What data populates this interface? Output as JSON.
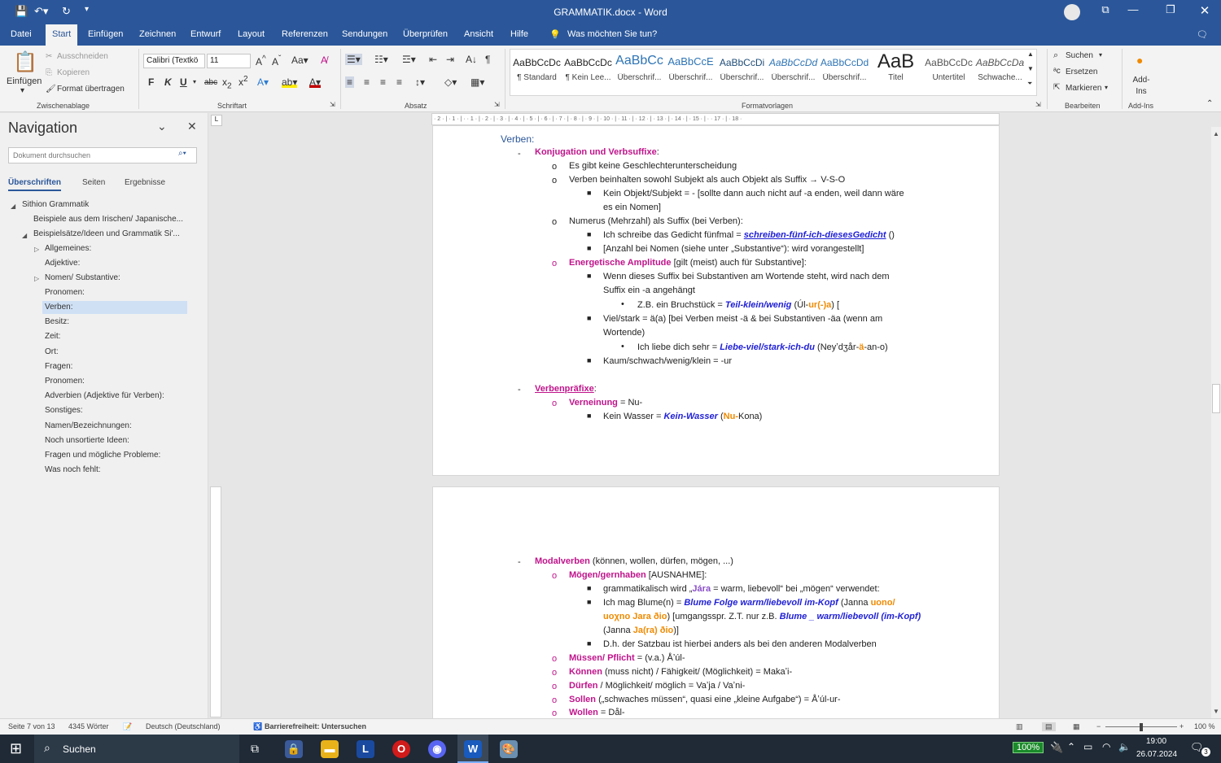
{
  "window": {
    "title": "GRAMMATIK.docx  -  Word"
  },
  "tabs": [
    "Datei",
    "Start",
    "Einfügen",
    "Zeichnen",
    "Entwurf",
    "Layout",
    "Referenzen",
    "Sendungen",
    "Überprüfen",
    "Ansicht",
    "Hilfe"
  ],
  "tell_me": "Was möchten Sie tun?",
  "ribbon": {
    "clipboard": {
      "paste": "Einfügen",
      "cut": "Ausschneiden",
      "copy": "Kopieren",
      "format_painter": "Format übertragen",
      "label": "Zwischenablage"
    },
    "font": {
      "name": "Calibri (Textkö",
      "size": "11",
      "label": "Schriftart"
    },
    "paragraph": {
      "label": "Absatz"
    },
    "styles": {
      "label": "Formatvorlagen",
      "items": [
        {
          "preview": "AaBbCcDc",
          "name": "¶ Standard"
        },
        {
          "preview": "AaBbCcDc",
          "name": "¶ Kein Lee..."
        },
        {
          "preview": "AaBbCc",
          "name": "Überschrif..."
        },
        {
          "preview": "AaBbCcE",
          "name": "Überschrif..."
        },
        {
          "preview": "AaBbCcDi",
          "name": "Überschrif..."
        },
        {
          "preview": "AaBbCcDd",
          "name": "Überschrif..."
        },
        {
          "preview": "AaBbCcDd",
          "name": "Überschrif..."
        },
        {
          "preview": "AaB",
          "name": "Titel"
        },
        {
          "preview": "AaBbCcDc",
          "name": "Untertitel"
        },
        {
          "preview": "AaBbCcDa",
          "name": "Schwache..."
        }
      ]
    },
    "editing": {
      "search": "Suchen",
      "replace": "Ersetzen",
      "select": "Markieren",
      "label": "Bearbeiten"
    },
    "addins": {
      "button": "Add-Ins",
      "label": "Add-Ins"
    }
  },
  "nav": {
    "title": "Navigation",
    "search_placeholder": "Dokument durchsuchen",
    "tabs": [
      "Überschriften",
      "Seiten",
      "Ergebnisse"
    ],
    "items": [
      {
        "label": "Sithion Grammatik"
      },
      {
        "label": "Beispiele aus dem Irischen/ Japanische..."
      },
      {
        "label": "Beispielsätze/Ideen und Grammatik Si'..."
      },
      {
        "label": "Allgemeines:"
      },
      {
        "label": "Adjektive:"
      },
      {
        "label": "Nomen/ Substantive:"
      },
      {
        "label": "Pronomen:"
      },
      {
        "label": "Verben:"
      },
      {
        "label": "Besitz:"
      },
      {
        "label": "Zeit:"
      },
      {
        "label": "Ort:"
      },
      {
        "label": "Fragen:"
      },
      {
        "label": "Pronomen:"
      },
      {
        "label": "Adverbien (Adjektive für Verben):"
      },
      {
        "label": "Sonstiges:"
      },
      {
        "label": "Namen/Bezeichnungen:"
      },
      {
        "label": "Noch unsortierte Ideen:"
      },
      {
        "label": "Fragen und mögliche Probleme:"
      },
      {
        "label": "Was noch fehlt:"
      }
    ]
  },
  "ruler": "· 2 · | · 1 · | · · 1 · | · 2 · | · 3 · | · 4 · | · 5 · | · 6 · | · 7 · | · 8 · | · 9 · | · 10 · | · 11 · | · 12 · | · 13 · | · 14 · | · 15 · | · · 17 · | · 18 ·",
  "doc": {
    "page1": {
      "heading": "Verben:",
      "l1_title": "Konjugation und Verbsuffixe",
      "l1_colon": ":",
      "l2": "Es gibt keine Geschlechterunterscheidung",
      "l3": "Verben beinhalten sowohl Subjekt als auch Objekt als Suffix → V-S-O",
      "l4a": "Kein Objekt/Subjekt = - [sollte dann auch nicht auf -a enden, weil dann wäre",
      "l4b": "es ein Nomen]",
      "l5": "Numerus (Mehrzahl) als Suffix (bei Verben):",
      "l6_pre": "Ich schreibe das Gedicht fünfmal = ",
      "l6_word": "schreiben-fünf-ich-diesesGedicht",
      "l6_post": " ()",
      "l7": "[Anzahl bei Nomen (siehe unter „Substantive“): wird vorangestellt]",
      "l8_title": "Energetische Amplitude",
      "l8_rest": " [gilt (meist) auch für Substantive]:",
      "l9a": "Wenn dieses Suffix bei Substantiven am Wortende steht, wird nach dem",
      "l9b": "Suffix ein -a angehängt",
      "l10_pre": "Z.B. ein Bruchstück = ",
      "l10_word": "Teil-klein/wenig",
      "l10_p1": " (Úl-",
      "l10_o": "ur(-)a",
      "l10_p2": ") [",
      "l11a": "Viel/stark = ä(a) [bei Verben meist -ä & bei Substantiven -äa (wenn am",
      "l11b": "Wortende)",
      "l12_pre": "Ich liebe dich sehr = ",
      "l12_word": "Liebe-viel/stark-ich-du",
      "l12_p1": " (Neyʼdʒår-",
      "l12_o": "ä",
      "l12_p2": "-an-o)",
      "l13": "Kaum/schwach/wenig/klein = -ur",
      "l14_title": "Verbenpräfixe",
      "l14_colon": ":",
      "l15_title": "Verneinung",
      "l15_rest": " = Nu-",
      "l16_pre": "Kein Wasser = ",
      "l16_word": "Kein-Wasser",
      "l16_p1": " (",
      "l16_o": "Nu-",
      "l16_p2": "Kona)"
    },
    "page2": {
      "l1_title": "Modalverben",
      "l1_rest": " (können, wollen, dürfen, mögen, ...)",
      "l2_title": "Mögen/gernhaben",
      "l2_rest": " [AUSNAHME]:",
      "l3_pre": "grammatikalisch wird „",
      "l3_word": "Jára",
      "l3_post": " = warm, liebevoll“ bei „mögen“ verwendet:",
      "l4_pre": "Ich mag Blume(n) = ",
      "l4_word": "Blume Folge warm/liebevoll im-Kopf",
      "l4_p1": " (Janna ",
      "l4_o": "uono/",
      "l5_o": "uoχno Jara ðio",
      "l5_p1": ") [umgangsspr. Z.T. nur z.B. ",
      "l5_word": "Blume _ warm/liebevoll (im-Kopf)",
      "l6_p1": "(Janna ",
      "l6_o": "Ja(ra) ðio",
      "l6_p2": ")]",
      "l7": "D.h. der Satzbau ist hierbei anders als bei den anderen Modalverben",
      "l8_title": "Müssen/ Pflicht",
      "l8_rest": " = (v.a.) Åʼúl-",
      "l9_title": "Können",
      "l9_rest": " (muss nicht) / Fähigkeit/ (Möglichkeit) = Makaʼi-",
      "l10_title": "Dürfen",
      "l10_rest": " / Möglichkeit/ möglich = Vaʼja / Vaʼni-",
      "l11_title": "Sollen",
      "l11_rest": " („schwaches müssen“, quasi eine „kleine Aufgabe“) = Åʼúl-ur-",
      "l12_title": "Wollen",
      "l12_rest": " = Dål-"
    }
  },
  "status": {
    "page": "Seite 7 von 13",
    "words": "4345 Wörter",
    "language": "Deutsch (Deutschland)",
    "accessibility": "Barrierefreiheit: Untersuchen",
    "zoom": "100 %"
  },
  "taskbar": {
    "search": "Suchen",
    "battery": "100%",
    "time": "19:00",
    "date": "26.07.2024",
    "notifications": "3"
  },
  "colors": {
    "word_blue": "#2b579a",
    "magenta": "#c0148b",
    "blue_italic": "#1f1fd6",
    "orange": "#f08a00"
  }
}
